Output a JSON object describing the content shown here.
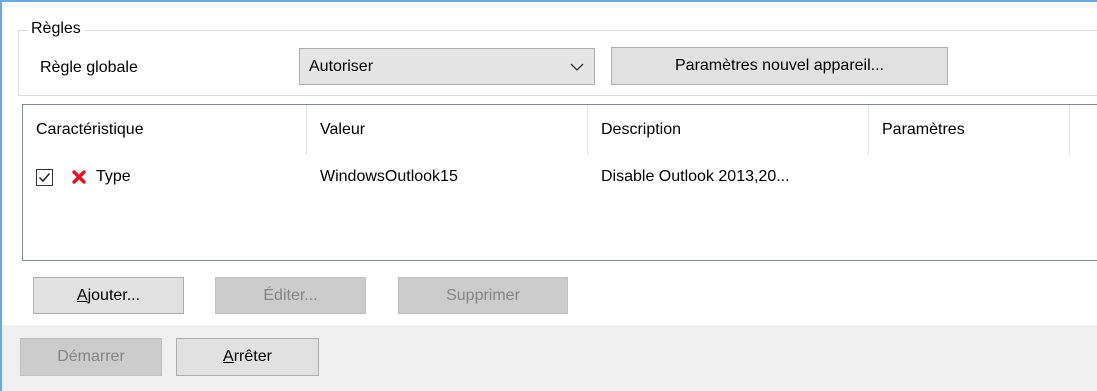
{
  "rules_group": {
    "legend": "Règles",
    "global_rule_label": "Règle globale",
    "global_rule_value": "Autoriser",
    "new_device_settings_label": "Paramètres nouvel appareil..."
  },
  "table": {
    "columns": [
      "Caractéristique",
      "Valeur",
      "Description",
      "Paramètres"
    ],
    "rows": [
      {
        "checked": true,
        "status_icon": "red-x-icon",
        "characteristic": "Type",
        "value": "WindowsOutlook15",
        "description": "Disable Outlook 2013,20...",
        "parameters": ""
      }
    ]
  },
  "actions": {
    "add_label_underlined": "A",
    "add_label_rest": "jouter...",
    "edit_label": "Éditer...",
    "delete_label": "Supprimer"
  },
  "controls": {
    "start_label": "Démarrer",
    "stop_label_underlined": "A",
    "stop_label_rest": "rrêter"
  },
  "colors": {
    "window_accent": "#6aa9e0",
    "delete_icon": "#e81123",
    "disabled_text": "#838383"
  }
}
